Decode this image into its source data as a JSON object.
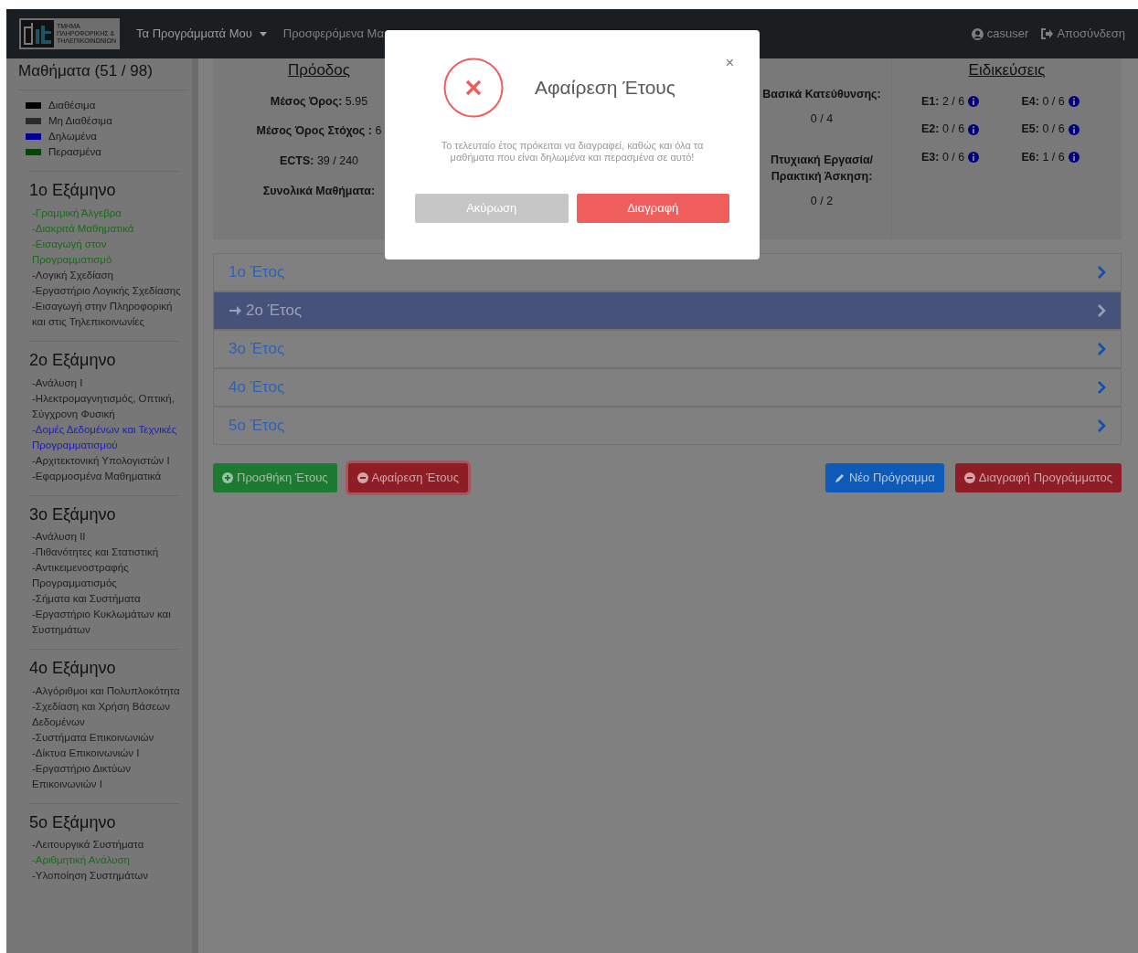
{
  "navbar": {
    "logo_lines": [
      "ΤΜΗΜΑ",
      "ΠΛΗΡΟΦΟΡΙΚΗΣ &",
      "ΤΗΛΕΠΙΚΟΙΝΩΝΙΩΝ"
    ],
    "menu": [
      {
        "label": "Τα Προγράμματά Μου",
        "kind": "dropdown"
      },
      {
        "label": "Προσφερόμενα Μα",
        "kind": "link"
      }
    ],
    "user": "casuser",
    "logout": "Αποσύνδεση"
  },
  "sidebar": {
    "title": "Μαθήματα (51 / 98)",
    "legend": [
      {
        "label": "Διαθέσιμα",
        "color": "#000000"
      },
      {
        "label": "Μη Διαθέσιμα",
        "color": "#2b2b2b"
      },
      {
        "label": "Δηλωμένα",
        "color": "#000099"
      },
      {
        "label": "Περασμένα",
        "color": "#004a00"
      }
    ],
    "semesters": [
      {
        "title": "1ο Εξάμηνο",
        "courses": [
          {
            "name": "-Γραμμική Άλγεβρα",
            "color": "#1a6b1a"
          },
          {
            "name": "-Διακριτά Μαθηματικά",
            "color": "#1a6b1a"
          },
          {
            "name": "-Εισαγωγή στον Προγραμματισμό",
            "color": "#1a6b1a"
          },
          {
            "name": "-Λογική Σχεδίαση",
            "color": "#1e1e1e"
          },
          {
            "name": "-Εργαστήριο Λογικής Σχεδίασης",
            "color": "#1e1e1e"
          },
          {
            "name": "-Εισαγωγή στην Πληροφορική και στις Τηλεπικοινωνίες",
            "color": "#1e1e1e"
          }
        ]
      },
      {
        "title": "2ο Εξάμηνο",
        "courses": [
          {
            "name": "-Ανάλυση I",
            "color": "#1e1e1e"
          },
          {
            "name": "-Ηλεκτρομαγνητισμός, Οπτική, Σύγχρονη Φυσική",
            "color": "#1e1e1e"
          },
          {
            "name": "-Δομές Δεδομένων και Τεχνικές Προγραμματισμού",
            "color": "#2020b0"
          },
          {
            "name": "-Αρχιτεκτονική Υπολογιστών I",
            "color": "#1e1e1e"
          },
          {
            "name": "-Εφαρμοσμένα Μαθηματικά",
            "color": "#1e1e1e"
          }
        ]
      },
      {
        "title": "3ο Εξάμηνο",
        "courses": [
          {
            "name": "-Ανάλυση II",
            "color": "#1e1e1e"
          },
          {
            "name": "-Πιθανότητες και Στατιστική",
            "color": "#1e1e1e"
          },
          {
            "name": "-Αντικειμενοστραφής Προγραμματισμός",
            "color": "#1e1e1e"
          },
          {
            "name": "-Σήματα και Συστήματα",
            "color": "#1e1e1e"
          },
          {
            "name": "-Εργαστήριο Κυκλωμάτων και Συστημάτων",
            "color": "#1e1e1e"
          }
        ]
      },
      {
        "title": "4ο Εξάμηνο",
        "courses": [
          {
            "name": "-Αλγόριθμοι και Πολυπλοκότητα",
            "color": "#1e1e1e"
          },
          {
            "name": "-Σχεδίαση και Χρήση Βάσεων Δεδομένων",
            "color": "#1e1e1e"
          },
          {
            "name": "-Συστήματα Επικοινωνιών",
            "color": "#1e1e1e"
          },
          {
            "name": "-Δίκτυα Επικοινωνιών I",
            "color": "#1e1e1e"
          },
          {
            "name": "-Εργαστήριο Δικτύων Επικοινωνιών I",
            "color": "#1e1e1e"
          }
        ]
      },
      {
        "title": "5ο Εξάμηνο",
        "courses": [
          {
            "name": "-Λειτουργικά Συστήματα",
            "color": "#1e1e1e"
          },
          {
            "name": "-Αριθμητική Ανάλυση",
            "color": "#1a6b1a"
          },
          {
            "name": "-Υλοποίηση Συστημάτων",
            "color": "#1e1e1e"
          }
        ]
      }
    ]
  },
  "progress": {
    "title": "Πρόοδος",
    "stats": [
      {
        "label": "Μέσος Όρος:",
        "value": "5.95"
      },
      {
        "label": "Μέσος Όρος Στόχος :",
        "value": "6"
      },
      {
        "label": "ECTS:",
        "value": "39 / 240"
      },
      {
        "label": "Συνολικά Μαθήματα:"
      }
    ],
    "categories": [
      {
        "label": "Βασικά Κατεύθυνσης:",
        "value": "0 / 4"
      },
      {
        "label": "Πτυχιακή Εργασία/ Πρακτική Άσκηση:",
        "value": "0 / 2"
      }
    ]
  },
  "specializations": {
    "title": "Ειδικεύσεις",
    "items": [
      {
        "label": "E1:",
        "value": "2 / 6"
      },
      {
        "label": "E4:",
        "value": "0 / 6"
      },
      {
        "label": "E2:",
        "value": "0 / 6"
      },
      {
        "label": "E5:",
        "value": "0 / 6"
      },
      {
        "label": "E3:",
        "value": "0 / 6"
      },
      {
        "label": "E6:",
        "value": "1 / 6"
      }
    ]
  },
  "years": [
    {
      "label": "1ο Έτος",
      "selected": false
    },
    {
      "label": "2ο Έτος",
      "selected": true
    },
    {
      "label": "3ο Έτος",
      "selected": false
    },
    {
      "label": "4ο Έτος",
      "selected": false
    },
    {
      "label": "5ο Έτος",
      "selected": false
    }
  ],
  "actions": [
    {
      "label": "Προσθήκη Έτους",
      "kind": "add"
    },
    {
      "label": "Αφαίρεση Έτους",
      "kind": "remove"
    },
    {
      "label": "Νέο Πρόγραμμα",
      "kind": "new"
    },
    {
      "label": "Διαγραφή Προγράμματος",
      "kind": "delete"
    }
  ],
  "modal": {
    "title": "Αφαίρεση Έτους",
    "message": "Το τελευταίο έτος πρόκειται να διαγραφεί, καθώς και όλα τα μαθήματα που είναι δηλωμένα και περασμένα σε αυτό!",
    "close": "×",
    "buttons": [
      {
        "label": "Ακύρωση",
        "kind": "cancel"
      },
      {
        "label": "Διαγραφή",
        "kind": "confirm"
      }
    ]
  }
}
